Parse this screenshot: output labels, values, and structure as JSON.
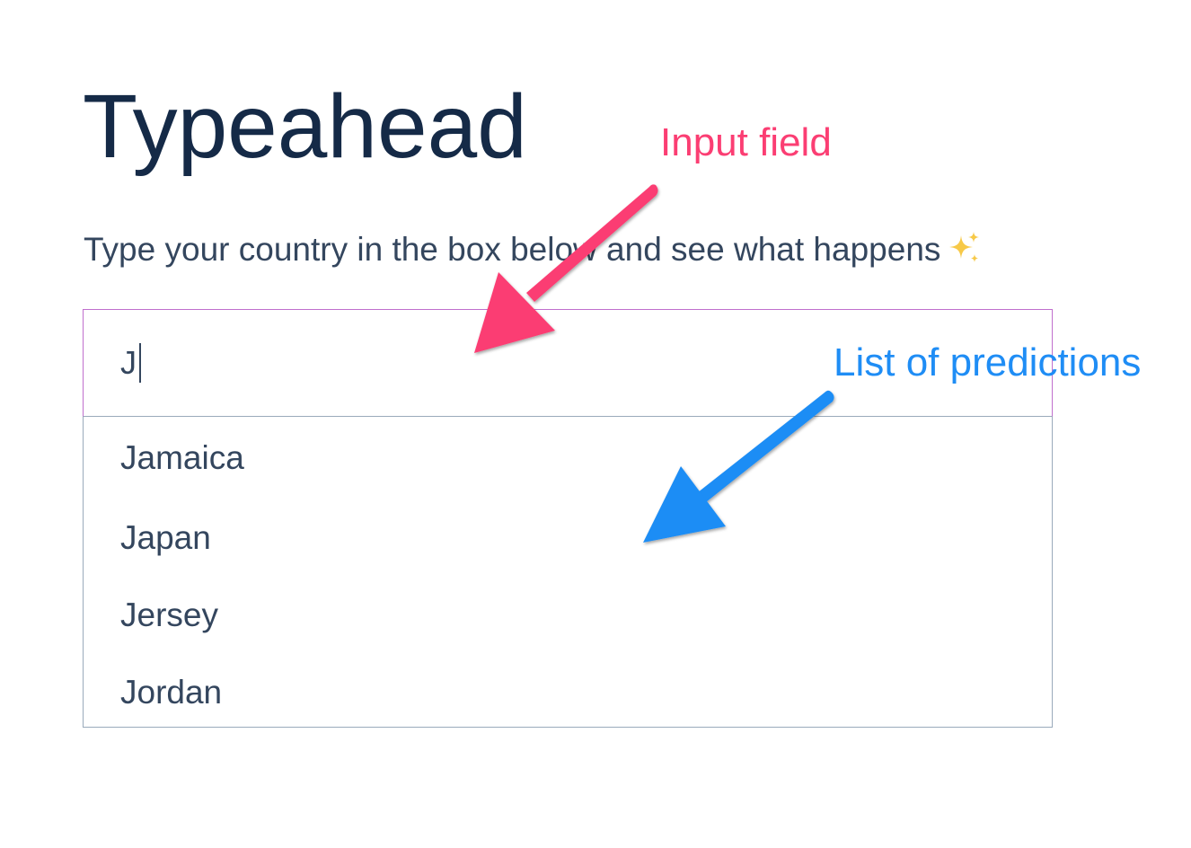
{
  "page": {
    "title": "Typeahead",
    "subtitle": "Type your country in the box below and see what happens"
  },
  "icons": {
    "subtitle_emoji": "sparkles-icon"
  },
  "input": {
    "value": "J"
  },
  "predictions": [
    "Jamaica",
    "Japan",
    "Jersey",
    "Jordan"
  ],
  "annotations": {
    "input_label": "Input field",
    "list_label": "List of predictions"
  },
  "colors": {
    "title": "#152a47",
    "text": "#34465e",
    "input_focus_border": "#c06fcd",
    "list_border": "#9aaabb",
    "annotation_input": "#fb3e73",
    "annotation_list": "#1f8df5",
    "sparkle": "#f7c948"
  }
}
